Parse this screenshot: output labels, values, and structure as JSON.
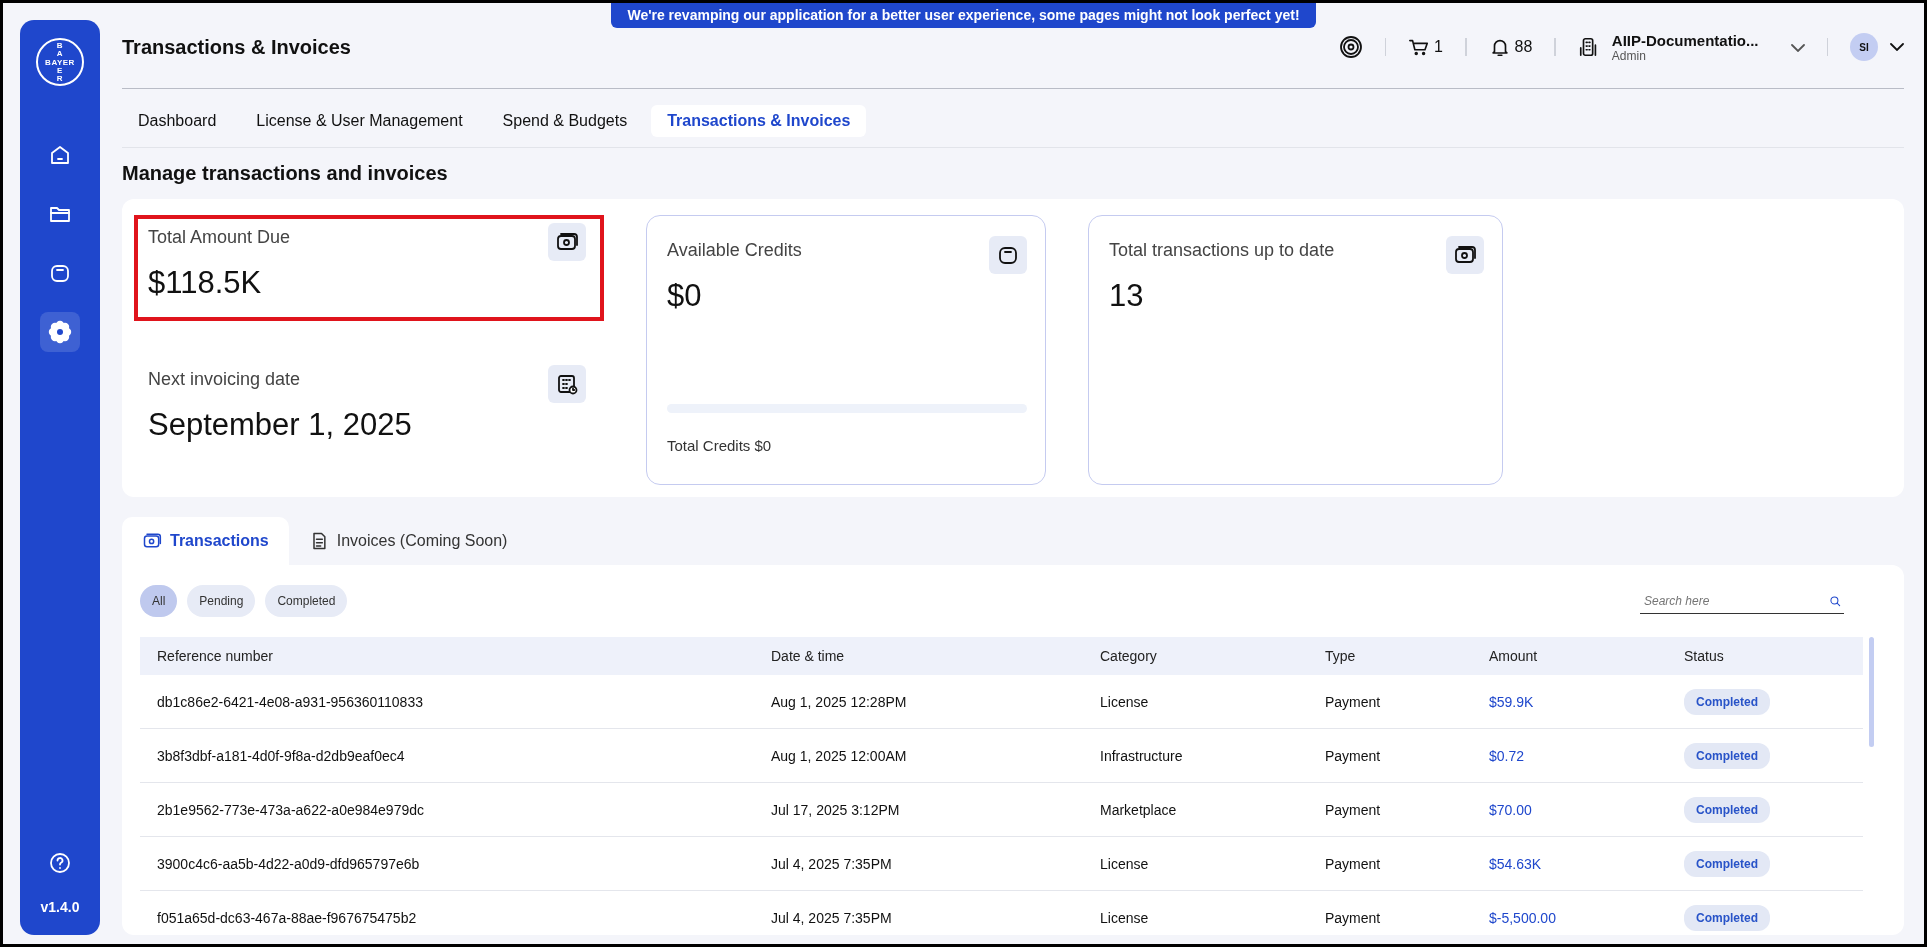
{
  "banner": "We're revamping our application for a better user experience, some pages might not look perfect yet!",
  "sidebar": {
    "logo": {
      "horizontal": "BAYER",
      "vertical_top": "BA",
      "vertical_bottom": "ER"
    },
    "items": [
      {
        "kind": "home",
        "selected": false
      },
      {
        "kind": "folder",
        "selected": false
      },
      {
        "kind": "bag",
        "selected": false
      },
      {
        "kind": "gear",
        "selected": true
      }
    ],
    "version": "v1.4.0"
  },
  "header": {
    "title": "Transactions & Invoices",
    "cart_count": "1",
    "notification_count": "88",
    "org_name": "AIIP-Documentatio...",
    "org_role": "Admin",
    "avatar": "SI"
  },
  "nav_tabs": [
    {
      "label": "Dashboard",
      "selected": false
    },
    {
      "label": "License & User Management",
      "selected": false
    },
    {
      "label": "Spend & Budgets",
      "selected": false
    },
    {
      "label": "Transactions & Invoices",
      "selected": true
    }
  ],
  "section_title": "Manage transactions and invoices",
  "summary": {
    "stats": [
      {
        "label": "Total Amount Due",
        "value": "$118.5K",
        "kind": "money",
        "highlighted": true
      },
      {
        "label": "Next invoicing date",
        "value": "September 1, 2025",
        "kind": "calendar",
        "highlighted": false
      }
    ],
    "credits": {
      "label": "Available Credits",
      "value": "$0",
      "level": 0,
      "footer": "Total Credits $0"
    },
    "transactions": {
      "label": "Total transactions up to date",
      "value": "13"
    }
  },
  "content_tabs": [
    {
      "label": "Transactions",
      "kind": "money",
      "selected": true
    },
    {
      "label": "Invoices (Coming Soon)",
      "kind": "document",
      "selected": false
    }
  ],
  "filters": [
    {
      "label": "All",
      "selected": true
    },
    {
      "label": "Pending",
      "selected": false
    },
    {
      "label": "Completed",
      "selected": false
    }
  ],
  "search": {
    "placeholder": "Search here"
  },
  "table": {
    "columns": [
      "Reference number",
      "Date & time",
      "Category",
      "Type",
      "Amount",
      "Status"
    ],
    "rows": [
      [
        "db1c86e2-6421-4e08-a931-956360110833",
        "Aug 1, 2025 12:28PM",
        "License",
        "Payment",
        "$59.9K",
        "Completed"
      ],
      [
        "3b8f3dbf-a181-4d0f-9f8a-d2db9eaf0ec4",
        "Aug 1, 2025 12:00AM",
        "Infrastructure",
        "Payment",
        "$0.72",
        "Completed"
      ],
      [
        "2b1e9562-773e-473a-a622-a0e984e979dc",
        "Jul 17, 2025 3:12PM",
        "Marketplace",
        "Payment",
        "$70.00",
        "Completed"
      ],
      [
        "3900c4c6-aa5b-4d22-a0d9-dfd965797e6b",
        "Jul 4, 2025 7:35PM",
        "License",
        "Payment",
        "$54.63K",
        "Completed"
      ],
      [
        "f051a65d-dc63-467a-88ae-f967675475b2",
        "Jul 4, 2025 7:35PM",
        "License",
        "Payment",
        "$-5,500.00",
        "Completed"
      ]
    ]
  }
}
